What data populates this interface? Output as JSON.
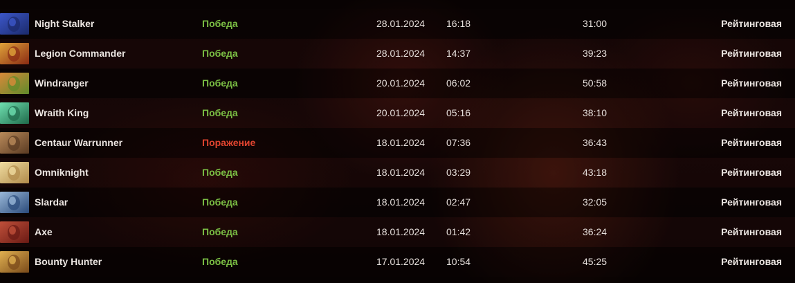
{
  "colors": {
    "win": "#7bbf44",
    "loss": "#e0442f"
  },
  "matches": [
    {
      "hero": "Night Stalker",
      "icon": "night-stalker-hero-icon",
      "result": "Победа",
      "outcome": "win",
      "date": "28.01.2024",
      "time": "16:18",
      "duration": "31:00",
      "mode": "Рейтинговая",
      "portrait": [
        "#1b2a6b",
        "#3c57c9"
      ]
    },
    {
      "hero": "Legion Commander",
      "icon": "legion-commander-hero-icon",
      "result": "Победа",
      "outcome": "win",
      "date": "28.01.2024",
      "time": "14:37",
      "duration": "39:23",
      "mode": "Рейтинговая",
      "portrait": [
        "#8a2a12",
        "#e0a23a"
      ]
    },
    {
      "hero": "Windranger",
      "icon": "windranger-hero-icon",
      "result": "Победа",
      "outcome": "win",
      "date": "20.01.2024",
      "time": "06:02",
      "duration": "50:58",
      "mode": "Рейтинговая",
      "portrait": [
        "#5f8a2a",
        "#d88a3a"
      ]
    },
    {
      "hero": "Wraith King",
      "icon": "wraith-king-hero-icon",
      "result": "Победа",
      "outcome": "win",
      "date": "20.01.2024",
      "time": "05:16",
      "duration": "38:10",
      "mode": "Рейтинговая",
      "portrait": [
        "#1f6a4a",
        "#6fe0b0"
      ]
    },
    {
      "hero": "Centaur Warrunner",
      "icon": "centaur-warrunner-hero-icon",
      "result": "Поражение",
      "outcome": "loss",
      "date": "18.01.2024",
      "time": "07:36",
      "duration": "36:43",
      "mode": "Рейтинговая",
      "portrait": [
        "#5a3a22",
        "#b98a5a"
      ]
    },
    {
      "hero": "Omniknight",
      "icon": "omniknight-hero-icon",
      "result": "Победа",
      "outcome": "win",
      "date": "18.01.2024",
      "time": "03:29",
      "duration": "43:18",
      "mode": "Рейтинговая",
      "portrait": [
        "#b08a4a",
        "#f0dca0"
      ]
    },
    {
      "hero": "Slardar",
      "icon": "slardar-hero-icon",
      "result": "Победа",
      "outcome": "win",
      "date": "18.01.2024",
      "time": "02:47",
      "duration": "32:05",
      "mode": "Рейтинговая",
      "portrait": [
        "#2a4a7a",
        "#9ab8d8"
      ]
    },
    {
      "hero": "Axe",
      "icon": "axe-hero-icon",
      "result": "Победа",
      "outcome": "win",
      "date": "18.01.2024",
      "time": "01:42",
      "duration": "36:24",
      "mode": "Рейтинговая",
      "portrait": [
        "#6a1a14",
        "#c0503a"
      ]
    },
    {
      "hero": "Bounty Hunter",
      "icon": "bounty-hunter-hero-icon",
      "result": "Победа",
      "outcome": "win",
      "date": "17.01.2024",
      "time": "10:54",
      "duration": "45:25",
      "mode": "Рейтинговая",
      "portrait": [
        "#7a4a1a",
        "#e0b050"
      ]
    }
  ]
}
